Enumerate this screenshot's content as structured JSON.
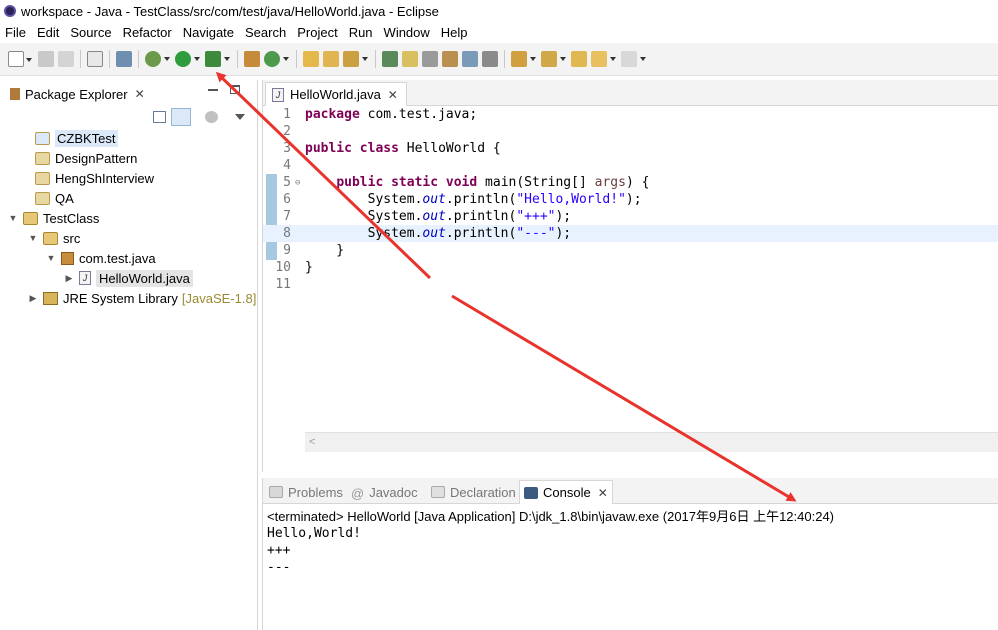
{
  "window": {
    "title": "workspace - Java - TestClass/src/com/test/java/HelloWorld.java - Eclipse"
  },
  "menu": [
    "File",
    "Edit",
    "Source",
    "Refactor",
    "Navigate",
    "Search",
    "Project",
    "Run",
    "Window",
    "Help"
  ],
  "left_view": {
    "tab_label": "Package Explorer",
    "close": "✕",
    "tree": [
      {
        "label": "CZBKTest"
      },
      {
        "label": "DesignPattern"
      },
      {
        "label": "HengShInterview"
      },
      {
        "label": "QA"
      },
      {
        "label": "TestClass"
      },
      {
        "label": "src"
      },
      {
        "label": "com.test.java"
      },
      {
        "label": "HelloWorld.java"
      },
      {
        "label": "JRE System Library",
        "decoration": "[JavaSE-1.8]"
      }
    ]
  },
  "editor": {
    "tab_label": "HelloWorld.java",
    "close": "✕",
    "line_numbers": [
      "1",
      "2",
      "3",
      "4",
      "5",
      "6",
      "7",
      "8",
      "9",
      "10",
      "11"
    ],
    "code": {
      "l1_kw": "package",
      "l1_rest": " com.test.java;",
      "l3_kw1": "public",
      "l3_kw2": "class",
      "l3_rest": " HelloWorld {",
      "l5_indent": "    ",
      "l5_kw1": "public",
      "l5_kw2": "static",
      "l5_kw3": "void",
      "l5_rest": " main(String[] ",
      "l5_args": "args",
      "l5_end": ") {",
      "l6_pre": "        System.",
      "l6_out": "out",
      "l6_mid": ".println(",
      "l6_str": "\"Hello,World!\"",
      "l6_end": ");",
      "l7_pre": "        System.",
      "l7_out": "out",
      "l7_mid": ".println(",
      "l7_str": "\"+++\"",
      "l7_end": ");",
      "l8_pre": "        System.",
      "l8_out": "out",
      "l8_mid": ".println(",
      "l8_str": "\"---\"",
      "l8_end": ");",
      "l9": "    }",
      "l10": "}"
    },
    "scroll_glyph": "<"
  },
  "console": {
    "tabs": [
      {
        "label": "Problems"
      },
      {
        "label": "Javadoc"
      },
      {
        "label": "Declaration"
      },
      {
        "label": "Console"
      }
    ],
    "close": "✕",
    "header": "<terminated> HelloWorld [Java Application] D:\\jdk_1.8\\bin\\javaw.exe (2017年9月6日 上午12:40:24)",
    "output": [
      "Hello,World!",
      "+++",
      "---"
    ]
  },
  "colors": {
    "keyword": "#7f0055",
    "string": "#2a00ff",
    "field": "#0000c0",
    "annotation_arrow": "#e8342c",
    "selection": "#dbe8f7"
  }
}
